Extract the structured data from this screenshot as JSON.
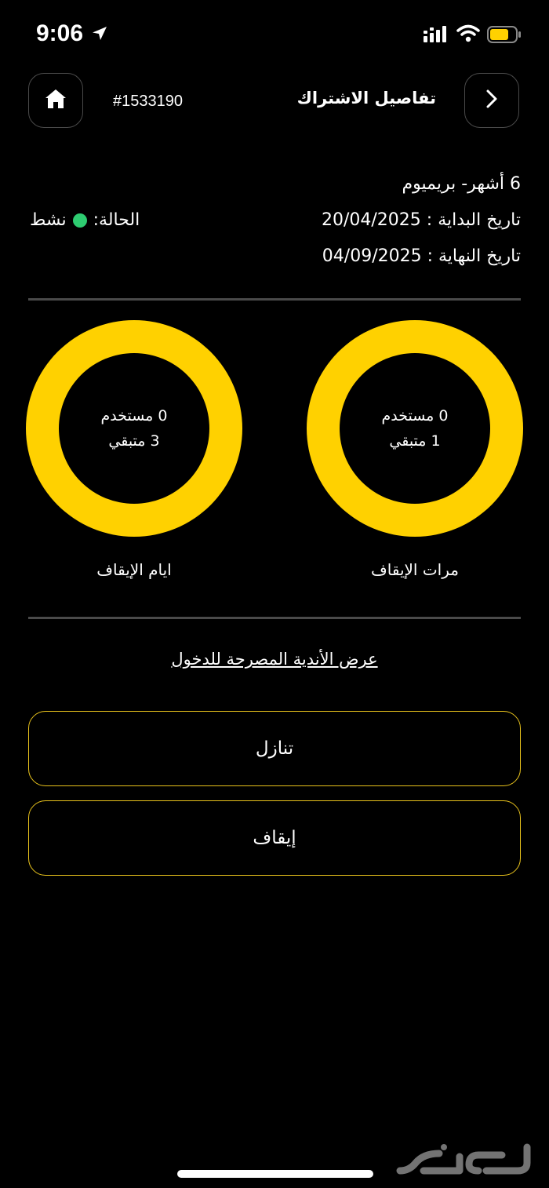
{
  "status_bar": {
    "time": "9:06",
    "icons": [
      "location-arrow-icon",
      "signal-icon",
      "wifi-icon",
      "battery-icon"
    ],
    "battery_color": "#FFD100"
  },
  "header": {
    "title": "تفاصيل الاشتراك",
    "subscription_id": "#1533190",
    "home_icon": "home-icon",
    "forward_icon": "chevron-right-icon"
  },
  "info": {
    "plan": "6 أشهر- بريميوم",
    "start_date": "تاريخ البداية : 20/04/2025",
    "end_date": "تاريخ النهاية : 04/09/2025",
    "status_label": "الحالة:",
    "status_value": "نشط",
    "status_color": "#2ecc71"
  },
  "rings": {
    "accent": "#FFD100",
    "freeze_count": {
      "used": "0 مستخدم",
      "remaining": "1 متبقي",
      "label": "مرات الإيقاف"
    },
    "freeze_days": {
      "used": "0 مستخدم",
      "remaining": "3 متبقي",
      "label": "ايام الإيقاف"
    }
  },
  "links": {
    "clubs": "عرض الأندية المصرحة للدخول"
  },
  "actions": {
    "transfer": "تنازل",
    "freeze": "إيقاف",
    "border_color": "#E8C21C"
  },
  "watermark": {
    "text": "حراج"
  }
}
